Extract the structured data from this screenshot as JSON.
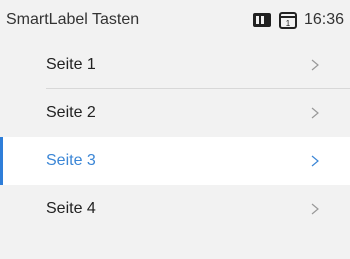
{
  "statusbar": {
    "app_title": "SmartLabel Tasten",
    "time": "16:36",
    "icons": [
      "battery-icon",
      "label-frame-icon"
    ]
  },
  "menu": {
    "items": [
      {
        "label": "Seite 1",
        "icon": "chevron-right-icon",
        "selected": false
      },
      {
        "label": "Seite 2",
        "icon": "chevron-right-icon",
        "selected": false
      },
      {
        "label": "Seite 3",
        "icon": "chevron-right-icon",
        "selected": true
      },
      {
        "label": "Seite 4",
        "icon": "chevron-right-icon",
        "selected": false
      }
    ]
  },
  "colors": {
    "accent": "#3b86d6",
    "background": "#f2f2f2",
    "selected_background": "#ffffff"
  }
}
